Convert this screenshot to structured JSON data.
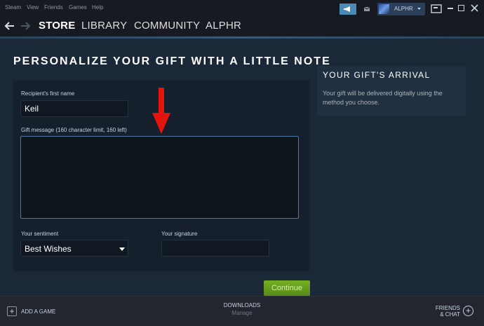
{
  "menu": {
    "items": [
      "Steam",
      "View",
      "Friends",
      "Games",
      "Help"
    ]
  },
  "account": {
    "name": "ALPHR"
  },
  "nav": {
    "links": [
      "STORE",
      "LIBRARY",
      "COMMUNITY",
      "ALPHR"
    ],
    "active": "STORE"
  },
  "page": {
    "title": "PERSONALIZE YOUR GIFT WITH A LITTLE NOTE"
  },
  "form": {
    "recipient_label": "Recipient's first name",
    "recipient_value": "Keil",
    "message_label": "Gift message (160 character limit, 160 left)",
    "message_value": "",
    "sentiment_label": "Your sentiment",
    "sentiment_value": "Best Wishes",
    "signature_label": "Your signature",
    "signature_value": "",
    "continue_label": "Continue"
  },
  "side": {
    "title": "YOUR GIFT'S ARRIVAL",
    "text": "Your gift will be delivered digitally using the method you choose."
  },
  "bottom": {
    "add_game": "ADD A GAME",
    "downloads": "DOWNLOADS",
    "downloads_sub": "Manage",
    "friends_line1": "FRIENDS",
    "friends_line2": "& CHAT"
  },
  "colors": {
    "background": "#1b2838",
    "accent_blue": "#4c8bb5",
    "continue_green": "#75b022",
    "annotation_arrow": "#e3140c"
  },
  "icons": {
    "announce": "megaphone-icon",
    "mail": "envelope-icon",
    "screenshot": "screenshot-icon",
    "back": "back-arrow-icon",
    "forward": "forward-arrow-icon",
    "dropdown": "caret-down-icon",
    "add_game": "plus-icon",
    "friends": "plus-circle-icon"
  }
}
